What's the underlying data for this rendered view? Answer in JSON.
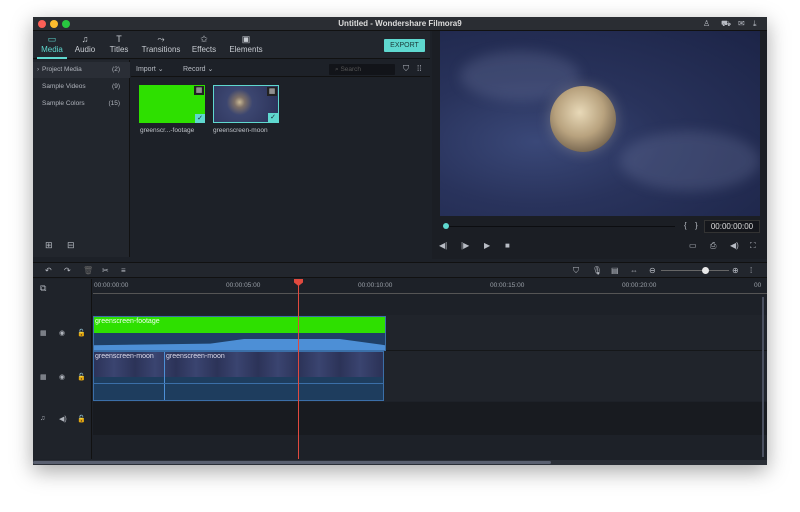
{
  "window": {
    "title": "Untitled - Wondershare Filmora9"
  },
  "tabs": [
    {
      "label": "Media",
      "icon": "folder-icon",
      "active": true
    },
    {
      "label": "Audio",
      "icon": "music-note-icon"
    },
    {
      "label": "Titles",
      "icon": "text-icon"
    },
    {
      "label": "Transitions",
      "icon": "transition-icon"
    },
    {
      "label": "Effects",
      "icon": "effects-icon"
    },
    {
      "label": "Elements",
      "icon": "image-icon"
    }
  ],
  "export_label": "EXPORT",
  "sidebar": [
    {
      "label": "Project Media",
      "count": "(2)"
    },
    {
      "label": "Sample Videos",
      "count": "(9)"
    },
    {
      "label": "Sample Colors",
      "count": "(15)"
    }
  ],
  "media_bar": {
    "import": "Import",
    "record": "Record",
    "search_placeholder": "Search"
  },
  "media_items": [
    {
      "label": "greenscr...-footage"
    },
    {
      "label": "greenscreen-moon"
    }
  ],
  "preview": {
    "timecode": "00:00:00:00",
    "progress": 0
  },
  "timeline": {
    "ruler": [
      "00:00:00:00",
      "00:00:05:00",
      "00:00:10:00",
      "00:00:15:00",
      "00:00:20:00",
      "00"
    ],
    "clips": {
      "footage": "greenscreen-footage",
      "moon1": "greenscreen-moon",
      "moon2": "greenscreen-moon"
    },
    "zoom_level": 0.8
  },
  "colors": {
    "accent": "#5fd8cf",
    "playhead": "#e04a3f",
    "green": "#2ee000"
  }
}
